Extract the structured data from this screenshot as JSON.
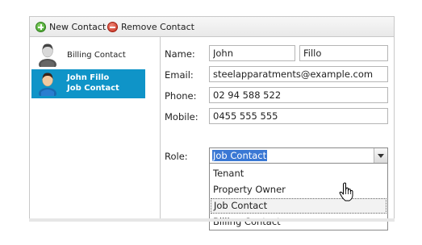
{
  "toolbar": {
    "new_contact_label": "New Contact",
    "remove_contact_label": "Remove Contact"
  },
  "contacts": [
    {
      "name": "Billing Contact",
      "role": "",
      "selected": false
    },
    {
      "name": "John Fillo",
      "role": "Job Contact",
      "selected": true
    }
  ],
  "form": {
    "labels": {
      "name": "Name:",
      "email": "Email:",
      "phone": "Phone:",
      "mobile": "Mobile:",
      "role": "Role:"
    },
    "first_name": "John",
    "last_name": "Fillo",
    "email": "steelapparatments@example.com",
    "phone": "02 94 588 522",
    "mobile": "0455 555 555",
    "role_selected": "Job Contact",
    "role_options": [
      "Tenant",
      "Property Owner",
      "Job Contact",
      "Billing Contact"
    ],
    "hovered_option": "Job Contact"
  },
  "icons": {
    "new_contact": "add-icon",
    "remove_contact": "remove-icon",
    "contact_avatar": "person-avatar-icon",
    "dropdown": "chevron-down-icon",
    "cursor": "hand-pointer-icon"
  },
  "colors": {
    "selected_bg": "#0f94c8",
    "selection_highlight": "#3a78d4",
    "add_icon": "#3b9a25",
    "remove_icon": "#c62a1a"
  }
}
